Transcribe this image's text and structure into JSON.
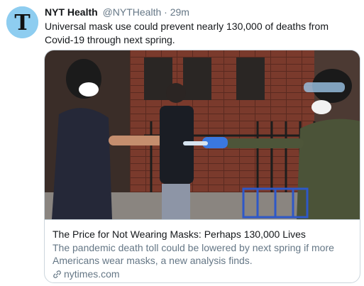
{
  "tweet": {
    "author_name": "NYT Health",
    "author_handle": "@NYTHealth",
    "separator": "·",
    "time": "29m",
    "text": "Universal mask use could prevent nearly 130,000 of deaths from Covid-19 through next spring."
  },
  "avatar": {
    "icon": "nyt-logo-icon",
    "glyph": "T",
    "background": "#8ecdf0"
  },
  "card": {
    "image_icon": "article-photo",
    "title": "The Price for Not Wearing Masks: Perhaps 130,000 Lives",
    "description": "The pandemic death toll could be lowered by next spring if more Americans wear masks, a new analysis finds.",
    "link_icon": "link-icon",
    "domain": "nytimes.com"
  },
  "colors": {
    "text_primary": "#14171a",
    "text_secondary": "#657786",
    "border": "#ccd6dd"
  }
}
